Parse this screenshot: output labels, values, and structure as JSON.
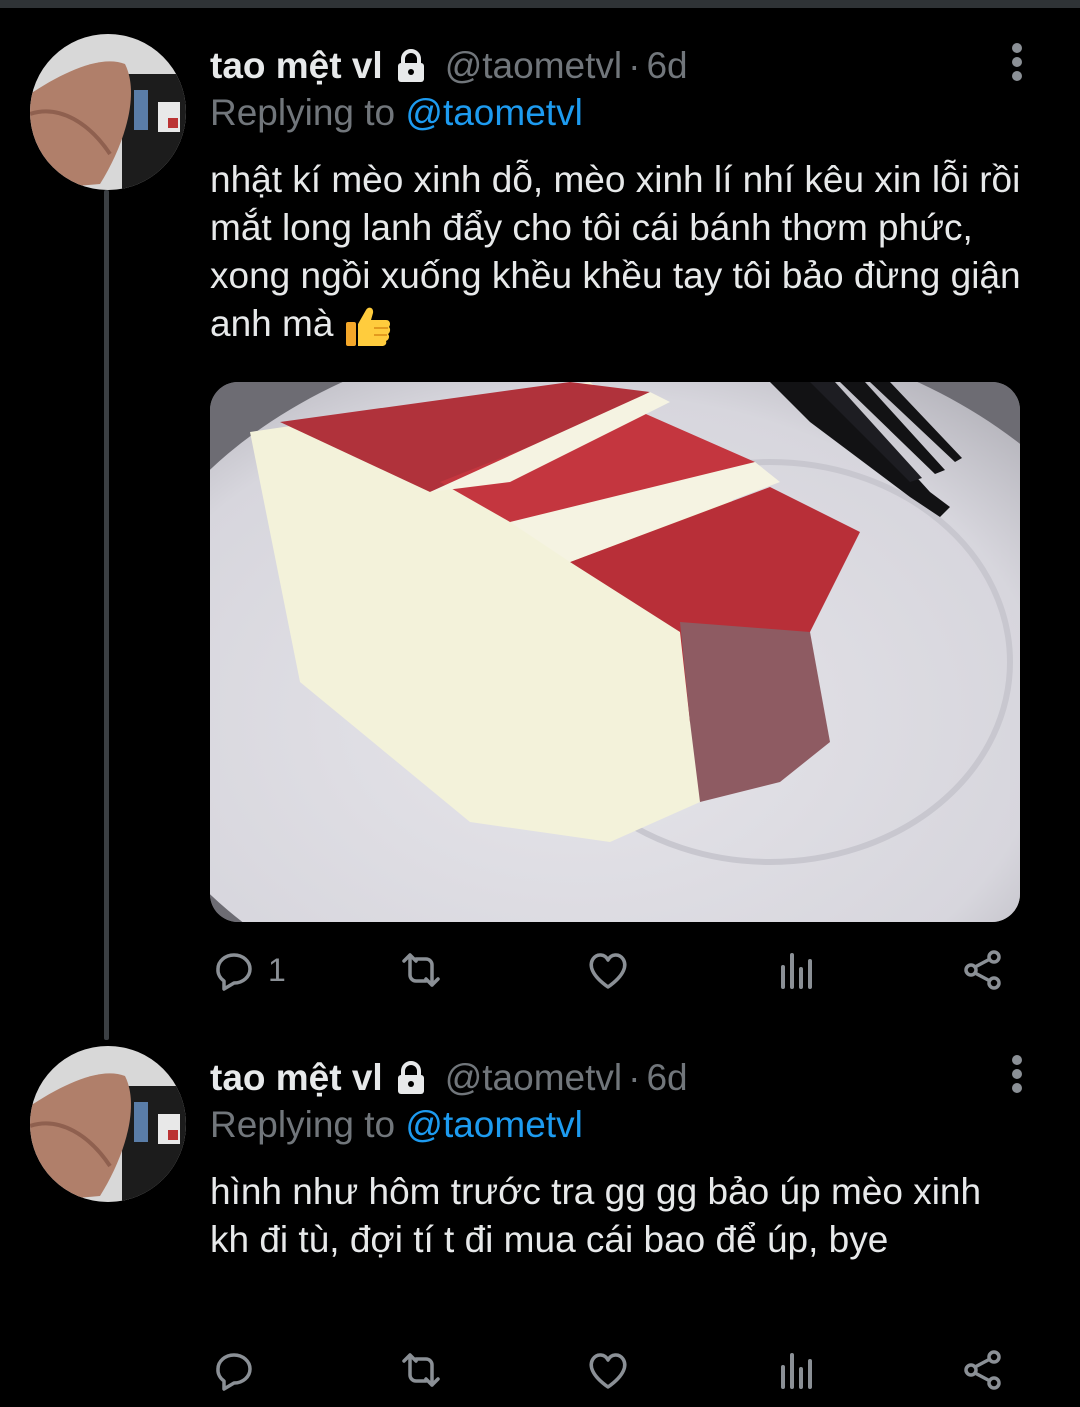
{
  "tweets": [
    {
      "display_name": "tao mệt vl",
      "handle": "@taometvl",
      "separator": "·",
      "time": "6d",
      "replying_prefix": "Replying to ",
      "replying_to": "@taometvl",
      "text": "nhật kí mèo xinh dỗ, mèo xinh lí nhí kêu xin lỗi rồi mắt long lanh đẩy cho tôi cái bánh thơm phức, xong ngồi xuống khều khều tay tôi bảo đừng giận anh mà",
      "emoji": "thumbs-up-icon",
      "media": {
        "alt": "",
        "subject": "slice of red velvet cake on a white plate with a black fork"
      },
      "reply_count": "1",
      "retweet_count": "",
      "like_count": ""
    },
    {
      "display_name": "tao mệt vl",
      "handle": "@taometvl",
      "separator": "·",
      "time": "6d",
      "replying_prefix": "Replying to ",
      "replying_to": "@taometvl",
      "text": "hình như hôm trước tra gg gg bảo úp mèo xinh kh đi tù, đợi tí t đi mua cái bao để úp, bye",
      "reply_count": "",
      "retweet_count": "",
      "like_count": ""
    }
  ],
  "colors": {
    "background": "#000000",
    "text_primary": "#e7e9ea",
    "text_secondary": "#71767b",
    "accent": "#1d9bf0",
    "thread_line": "#3b3f43"
  },
  "icons": [
    "lock-icon",
    "more-options-icon",
    "reply-icon",
    "retweet-icon",
    "like-icon",
    "analytics-icon",
    "share-icon"
  ]
}
